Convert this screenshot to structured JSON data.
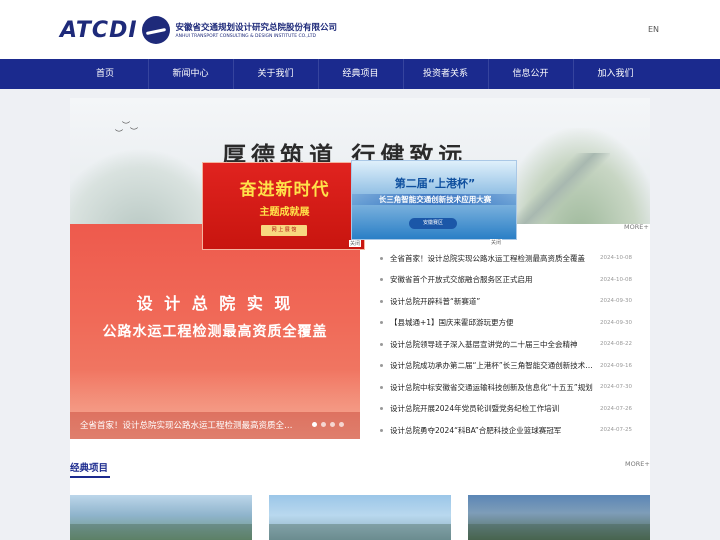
{
  "header": {
    "logo_word": "ATCDI",
    "company_cn": "安徽省交通规划设计研究总院股份有限公司",
    "company_en": "ANHUI TRANSPORT CONSULTING & DESIGN INSTITUTE CO.,LTD",
    "lang": "EN"
  },
  "nav": {
    "items": [
      {
        "label": "首页"
      },
      {
        "label": "新闻中心"
      },
      {
        "label": "关于我们"
      },
      {
        "label": "经典项目"
      },
      {
        "label": "投资者关系"
      },
      {
        "label": "信息公开"
      },
      {
        "label": "加入我们"
      }
    ]
  },
  "hero": {
    "slogan": "厚德筑道  行健致远"
  },
  "popup1": {
    "title": "奋进新时代",
    "subtitle": "主题成就展",
    "button": "网 上 展 馆",
    "close": "关闭"
  },
  "popup2": {
    "title": "第二届“上港杯”",
    "subtitle": "长三角智能交通创新技术应用大赛",
    "button": "安徽赛区",
    "close": "关闭"
  },
  "carousel": {
    "headline1": "设 计 总 院 实 现",
    "headline2": "公路水运工程检测最高资质全覆盖",
    "caption": "全省首家！设计总院实现公路水运工程检测最高资质全覆盖",
    "slide_count": 4,
    "active_slide": 1
  },
  "news": {
    "more": "MORE+",
    "items": [
      {
        "title": "全省首家！设计总院实现公路水运工程检测最高资质全覆盖",
        "date": "2024-10-08"
      },
      {
        "title": "安徽省首个开放式交旅融合服务区正式启用",
        "date": "2024-10-08"
      },
      {
        "title": "设计总院开辟科普“新赛道”",
        "date": "2024-09-30"
      },
      {
        "title": "【县城通+1】国庆来霍邱游玩更方便",
        "date": "2024-09-30"
      },
      {
        "title": "设计总院领导班子深入基层宣讲党的二十届三中全会精神",
        "date": "2024-08-22"
      },
      {
        "title": "设计总院成功承办第二届“上港杯”长三角智能交通创新技术应用大赛",
        "date": "2024-09-16"
      },
      {
        "title": "设计总院中标安徽省交通运输科技创新及信息化“十五五”规划",
        "date": "2024-07-30"
      },
      {
        "title": "设计总院开展2024年党员轮训暨党务纪检工作培训",
        "date": "2024-07-26"
      },
      {
        "title": "设计总院勇夺2024“科BA”合肥科技企业篮球赛冠军",
        "date": "2024-07-25"
      }
    ]
  },
  "projects": {
    "title": "经典项目",
    "more": "MORE+"
  }
}
